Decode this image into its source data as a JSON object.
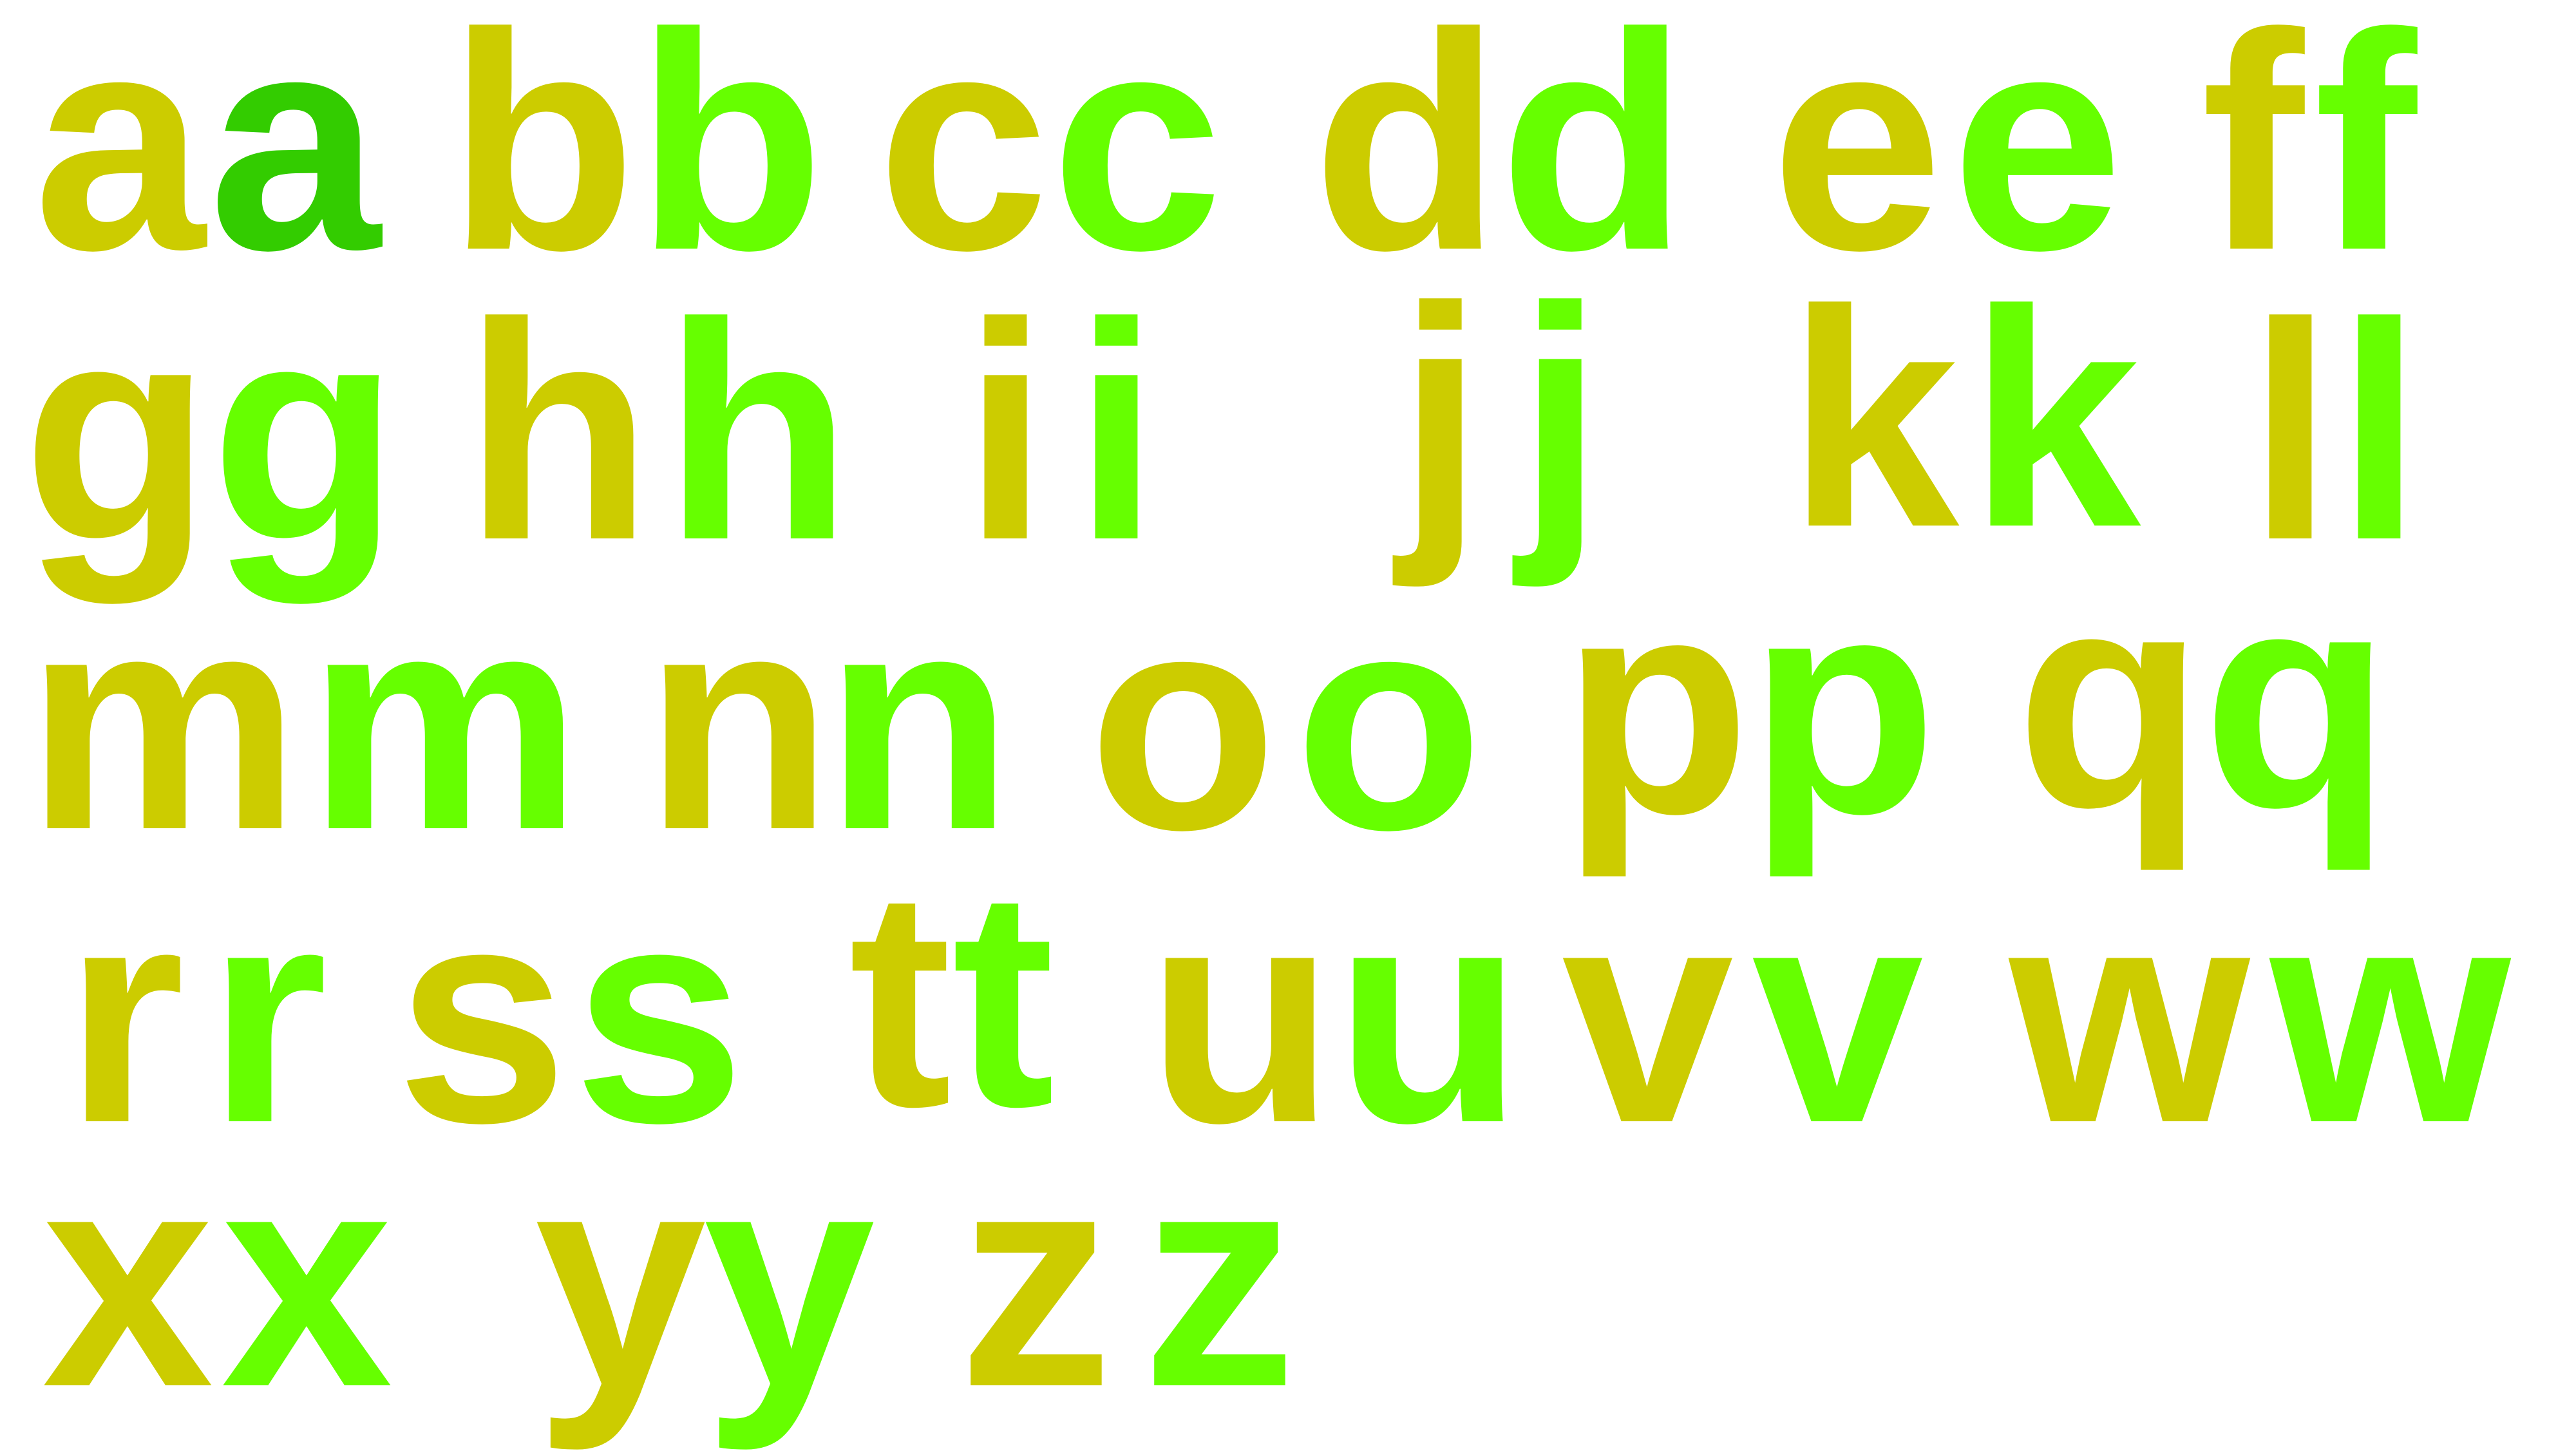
{
  "colors": {
    "olive": "#cccc00",
    "lime": "#66ff00",
    "green": "#33cc00"
  },
  "letters": {
    "a": {
      "first": "a",
      "second": "a",
      "first_color": "#cccc00",
      "second_color": "#33cc00"
    },
    "b": {
      "first": "b",
      "second": "b",
      "first_color": "#cccc00",
      "second_color": "#66ff00"
    },
    "c": {
      "first": "c",
      "second": "c",
      "first_color": "#cccc00",
      "second_color": "#66ff00"
    },
    "d": {
      "first": "d",
      "second": "d",
      "first_color": "#cccc00",
      "second_color": "#66ff00"
    },
    "e": {
      "first": "e",
      "second": "e",
      "first_color": "#cccc00",
      "second_color": "#66ff00"
    },
    "f": {
      "first": "f",
      "second": "f",
      "first_color": "#cccc00",
      "second_color": "#66ff00"
    },
    "g": {
      "first": "g",
      "second": "g",
      "first_color": "#cccc00",
      "second_color": "#66ff00"
    },
    "h": {
      "first": "h",
      "second": "h",
      "first_color": "#cccc00",
      "second_color": "#66ff00"
    },
    "i": {
      "first": "i",
      "second": "i",
      "first_color": "#cccc00",
      "second_color": "#66ff00"
    },
    "j": {
      "first": "j",
      "second": "j",
      "first_color": "#cccc00",
      "second_color": "#66ff00"
    },
    "k": {
      "first": "k",
      "second": "k",
      "first_color": "#cccc00",
      "second_color": "#66ff00"
    },
    "l": {
      "first": "l",
      "second": "l",
      "first_color": "#cccc00",
      "second_color": "#66ff00"
    },
    "m": {
      "first": "m",
      "second": "m",
      "first_color": "#cccc00",
      "second_color": "#66ff00"
    },
    "n": {
      "first": "n",
      "second": "n",
      "first_color": "#cccc00",
      "second_color": "#66ff00"
    },
    "o": {
      "first": "o",
      "second": "o",
      "first_color": "#cccc00",
      "second_color": "#66ff00"
    },
    "p": {
      "first": "p",
      "second": "p",
      "first_color": "#cccc00",
      "second_color": "#66ff00"
    },
    "q": {
      "first": "q",
      "second": "q",
      "first_color": "#cccc00",
      "second_color": "#66ff00"
    },
    "r": {
      "first": "r",
      "second": "r",
      "first_color": "#cccc00",
      "second_color": "#66ff00"
    },
    "s": {
      "first": "s",
      "second": "s",
      "first_color": "#cccc00",
      "second_color": "#66ff00"
    },
    "t": {
      "first": "t",
      "second": "t",
      "first_color": "#cccc00",
      "second_color": "#66ff00"
    },
    "u": {
      "first": "u",
      "second": "u",
      "first_color": "#cccc00",
      "second_color": "#66ff00"
    },
    "v": {
      "first": "v",
      "second": "v",
      "first_color": "#cccc00",
      "second_color": "#66ff00"
    },
    "w": {
      "first": "w",
      "second": "w",
      "first_color": "#cccc00",
      "second_color": "#66ff00"
    },
    "x": {
      "first": "x",
      "second": "x",
      "first_color": "#cccc00",
      "second_color": "#66ff00"
    },
    "y": {
      "first": "y",
      "second": "y",
      "first_color": "#cccc00",
      "second_color": "#66ff00"
    },
    "z": {
      "first": "z",
      "second": "z",
      "first_color": "#cccc00",
      "second_color": "#66ff00"
    }
  }
}
